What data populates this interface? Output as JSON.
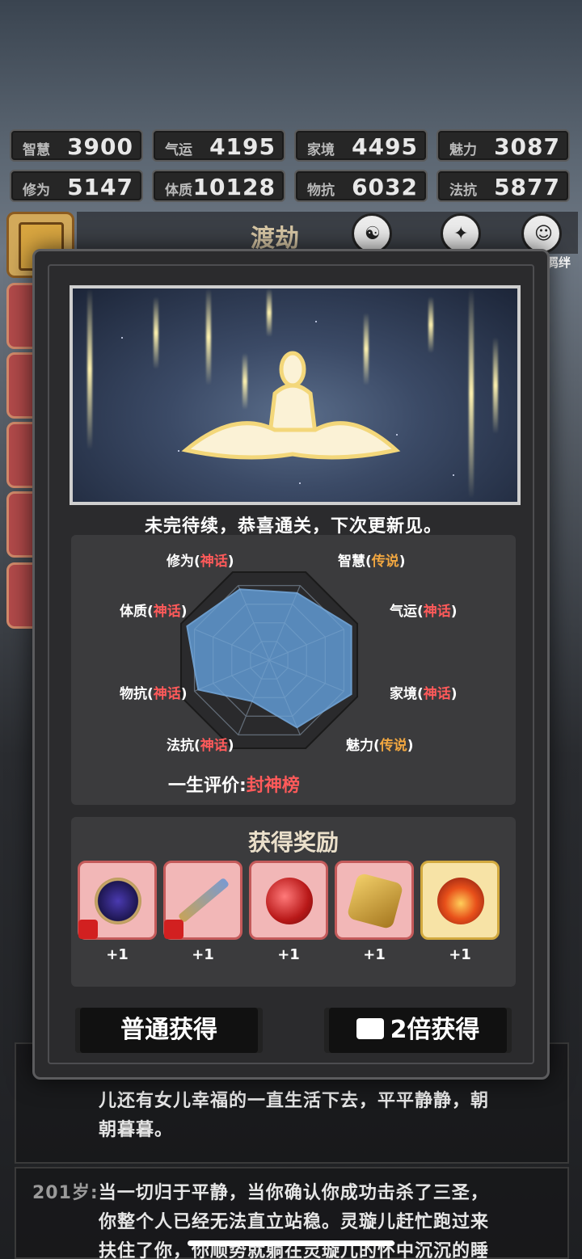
{
  "stats": [
    {
      "label": "智慧",
      "value": "3900"
    },
    {
      "label": "气运",
      "value": "4195"
    },
    {
      "label": "家境",
      "value": "4495"
    },
    {
      "label": "魅力",
      "value": "3087"
    },
    {
      "label": "修为",
      "value": "5147"
    },
    {
      "label": "体质",
      "value": "10128"
    },
    {
      "label": "物抗",
      "value": "6032"
    },
    {
      "label": "法抗",
      "value": "5877"
    }
  ],
  "header": {
    "title": "渡劫",
    "side_label": "羁绊",
    "icons": [
      "meditation-icon",
      "beast-icon",
      "portrait-icon"
    ]
  },
  "story": {
    "line1": "儿还有女儿幸福的一直生活下去，平平静静，朝",
    "line2": "朝暮暮。",
    "age": "201岁:",
    "line3": "当一切归于平静，当你确认你成功击杀了三圣，",
    "line4": "你整个人已经无法直立站稳。灵璇儿赶忙跑过来",
    "line5": "扶住了你，你顺势就躺在灵璇儿的怀中沉沉的睡"
  },
  "modal": {
    "message": "未完待续，恭喜通关，下次更新见。",
    "attributes": [
      {
        "name": "修为",
        "rank": "神话",
        "tier": "myth"
      },
      {
        "name": "智慧",
        "rank": "传说",
        "tier": "legend"
      },
      {
        "name": "气运",
        "rank": "神话",
        "tier": "myth"
      },
      {
        "name": "家境",
        "rank": "神话",
        "tier": "myth"
      },
      {
        "name": "魅力",
        "rank": "传说",
        "tier": "legend"
      },
      {
        "name": "法抗",
        "rank": "神话",
        "tier": "myth"
      },
      {
        "name": "物抗",
        "rank": "神话",
        "tier": "myth"
      },
      {
        "name": "体质",
        "rank": "神话",
        "tier": "myth"
      }
    ],
    "verdict_label": "一生评价:",
    "verdict_value": "封神榜",
    "reward_title": "获得奖励",
    "rewards": [
      {
        "icon": "mirror-icon",
        "count": "+1"
      },
      {
        "icon": "sword-icon",
        "count": "+1"
      },
      {
        "icon": "red-orb-icon",
        "count": "+1"
      },
      {
        "icon": "gold-token-icon",
        "count": "+1"
      },
      {
        "icon": "fire-orb-icon",
        "count": "+1"
      }
    ],
    "btn_normal": "普通获得",
    "btn_double": "2倍获得"
  },
  "colors": {
    "myth": "#ff5a5a",
    "legend": "#f0a640",
    "radar_fill": "#5b8fc2"
  }
}
